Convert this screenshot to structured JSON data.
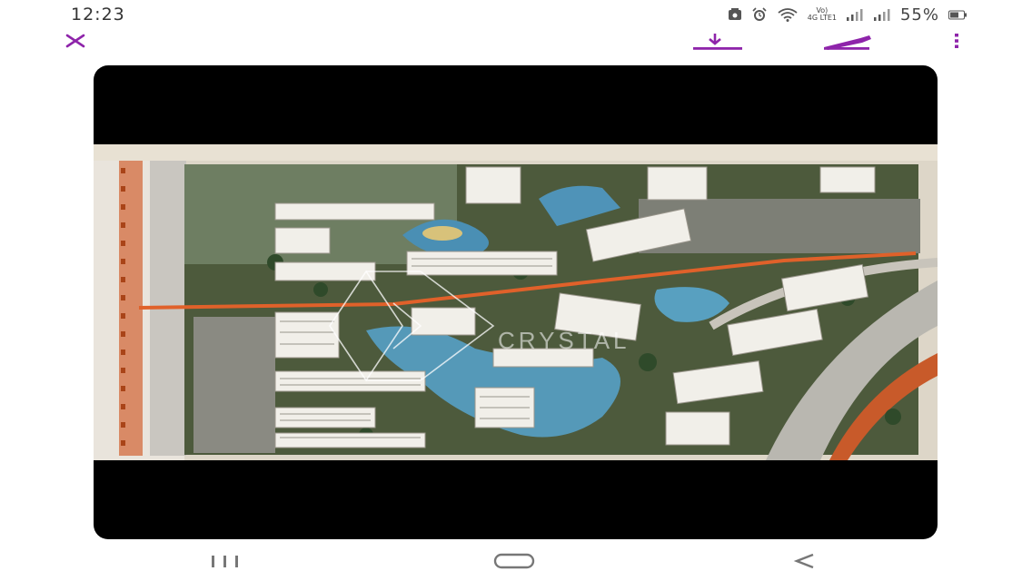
{
  "status_bar": {
    "time": "12:23",
    "network_label_top": "Vo)",
    "network_label_bottom": "4G LTE1",
    "battery_percent": "55%",
    "icons": [
      "image-notification-icon",
      "alarm-icon",
      "wifi-icon",
      "volte-icon",
      "signal-icon",
      "signal-icon",
      "battery-icon"
    ]
  },
  "toolbar": {
    "accent_color": "#8e24aa",
    "icons": [
      "close-icon",
      "download-icon",
      "edit-icon",
      "more-vertical-icon"
    ]
  },
  "viewer": {
    "background": "#000000",
    "image_watermark": "CRYSTAL"
  },
  "navbar": {
    "icons": [
      "recent-apps-icon",
      "home-icon",
      "back-icon"
    ]
  }
}
